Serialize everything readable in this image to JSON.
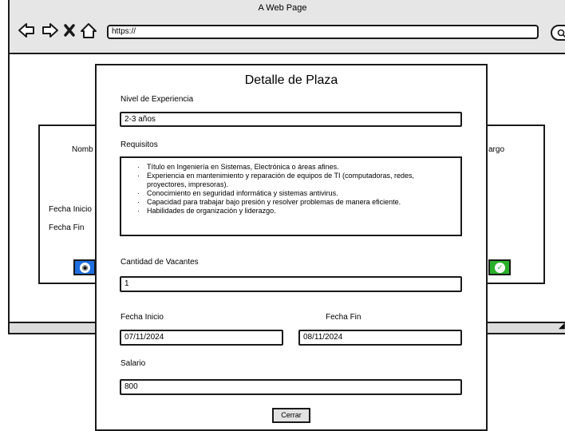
{
  "browser": {
    "title": "A Web Page",
    "url": "https://"
  },
  "background": {
    "nombre_label": "Nomb",
    "cargo_label": "argo",
    "fecha_inicio_label": "Fecha Inicio",
    "fecha_fin_label": "Fecha Fin"
  },
  "modal": {
    "title": "Detalle de Plaza",
    "experience_label": "Nivel de Experiencia",
    "experience_value": "2-3 años",
    "requirements_label": "Requisitos",
    "requirements": [
      "Título en Ingeniería en Sistemas, Electrónica o áreas afines.",
      "Experiencia en mantenimiento y reparación de equipos de TI (computadoras, redes, proyectores, impresoras).",
      "Conocimiento en seguridad informática y sistemas antivirus.",
      "Capacidad para trabajar bajo presión y resolver problemas de manera eficiente.",
      "Habilidades de organización y liderazgo."
    ],
    "vacancies_label": "Cantidad de Vacantes",
    "vacancies_value": "1",
    "start_label": "Fecha Inicio",
    "start_value": "07/11/2024",
    "end_label": "Fecha Fin",
    "end_value": "08/11/2024",
    "salary_label": "Salario",
    "salary_value": "800",
    "close_label": "Cerrar"
  }
}
